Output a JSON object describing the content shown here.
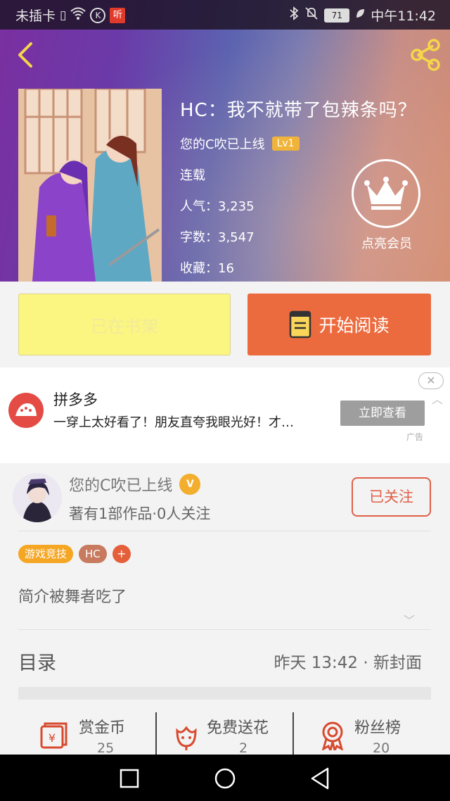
{
  "status_bar": {
    "carrier": "未插卡",
    "listen_badge": "听",
    "battery": "71",
    "time": "中午11:42"
  },
  "book": {
    "title": "HC：我不就带了包辣条吗？",
    "author": "您的C吹已上线",
    "level": "Lv1",
    "status": "连载",
    "popularity": "人气：3,235",
    "word_count": "字数：3,547",
    "favorites": "收藏：16"
  },
  "vip": {
    "label": "点亮会员"
  },
  "actions": {
    "shelf_label": "已在书架",
    "read_label": "开始阅读"
  },
  "ad": {
    "title": "拼多多",
    "description": "一穿上太好看了！朋友直夸我眼光好！才…",
    "button": "立即查看",
    "tag": "广告"
  },
  "author_card": {
    "name": "您的C吹已上线",
    "verified_badge": "V",
    "stats": "著有1部作品·0人关注",
    "follow_label": "已关注",
    "tags": [
      "游戏竞技",
      "HC",
      "+"
    ],
    "intro": "简介被舞者吃了"
  },
  "toc": {
    "label": "目录",
    "update": "昨天 13:42 · 新封面"
  },
  "bottom_stats": [
    {
      "label": "赏金币",
      "value": "25",
      "icon": "gold-coin-icon"
    },
    {
      "label": "免费送花",
      "value": "2",
      "icon": "flower-icon"
    },
    {
      "label": "粉丝榜",
      "value": "20",
      "icon": "medal-icon"
    }
  ],
  "colors": {
    "accent_orange": "#ec6b3e",
    "shelf_yellow": "#fbf582",
    "level_badge": "#f0b43a",
    "follow_red": "#e06048"
  }
}
